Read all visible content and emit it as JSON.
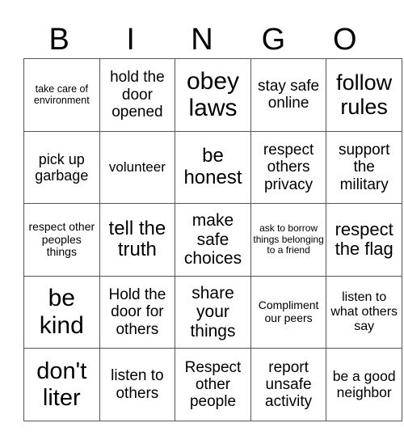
{
  "header": [
    "B",
    "I",
    "N",
    "G",
    "O"
  ],
  "cells": [
    [
      "take care of environment",
      "hold the door opened",
      "obey laws",
      "stay safe online",
      "follow rules"
    ],
    [
      "pick up garbage",
      "volunteer",
      "be honest",
      "respect others privacy",
      "support the military"
    ],
    [
      "respect other peoples things",
      "tell the truth",
      "make safe choices",
      "ask to borrow things belonging to a friend",
      "respect the flag"
    ],
    [
      "be kind",
      "Hold the door for others",
      "share your things",
      "Compliment our peers",
      "listen to what others say"
    ],
    [
      "don't liter",
      "listen to others",
      "Respect other people",
      "report unsafe activity",
      "be a good neighbor"
    ]
  ]
}
